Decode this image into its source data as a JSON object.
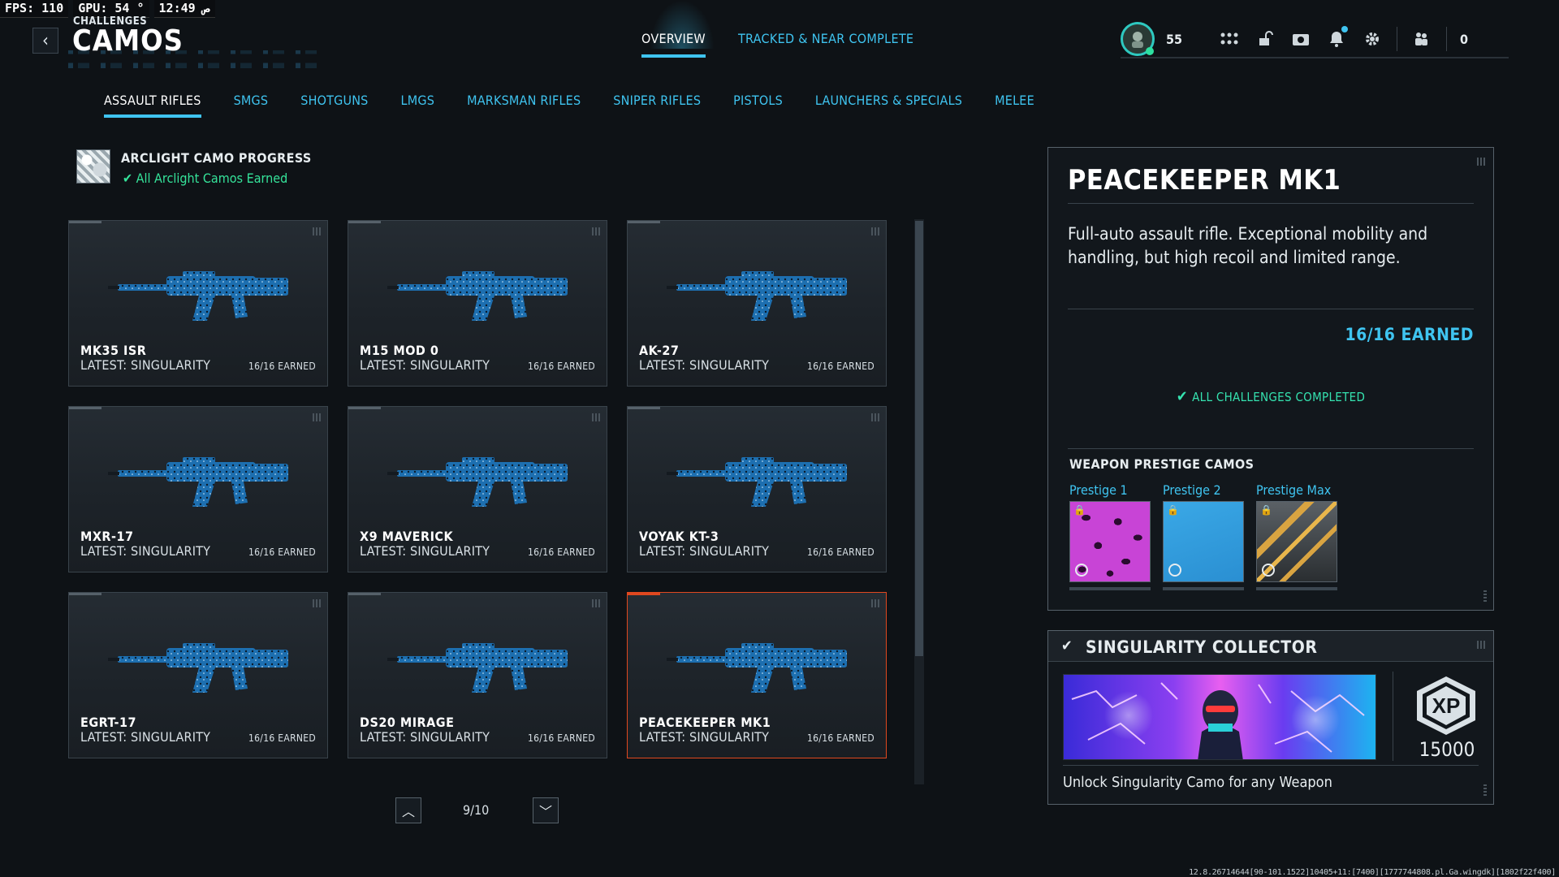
{
  "hud": {
    "fps": "FPS: 110",
    "gpu": "GPU: 54 °",
    "time": "12:49 ص"
  },
  "header": {
    "breadcrumb": "CHALLENGES",
    "title": "CAMOS",
    "tabs": [
      {
        "label": "OVERVIEW",
        "active": true
      },
      {
        "label": "TRACKED & NEAR COMPLETE",
        "active": false
      }
    ],
    "player_level": "55",
    "party_count": "0",
    "icons": [
      "grid-icon",
      "unlock-icon",
      "camera-icon",
      "bell-icon",
      "gear-icon",
      "party-icon"
    ]
  },
  "categories": [
    {
      "label": "ASSAULT RIFLES",
      "active": true
    },
    {
      "label": "SMGS"
    },
    {
      "label": "SHOTGUNS"
    },
    {
      "label": "LMGS"
    },
    {
      "label": "MARKSMAN RIFLES"
    },
    {
      "label": "SNIPER RIFLES"
    },
    {
      "label": "PISTOLS"
    },
    {
      "label": "LAUNCHERS & SPECIALS"
    },
    {
      "label": "MELEE"
    }
  ],
  "arclight": {
    "title": "ARCLIGHT CAMO PROGRESS",
    "status": "All Arclight Camos Earned",
    "status_color": "#35e39a"
  },
  "weapons": [
    {
      "name": "MK35 ISR",
      "latest": "LATEST: SINGULARITY",
      "earned": "16/16 EARNED"
    },
    {
      "name": "M15 MOD 0",
      "latest": "LATEST: SINGULARITY",
      "earned": "16/16 EARNED"
    },
    {
      "name": "AK-27",
      "latest": "LATEST: SINGULARITY",
      "earned": "16/16 EARNED"
    },
    {
      "name": "MXR-17",
      "latest": "LATEST: SINGULARITY",
      "earned": "16/16 EARNED"
    },
    {
      "name": "X9 MAVERICK",
      "latest": "LATEST: SINGULARITY",
      "earned": "16/16 EARNED"
    },
    {
      "name": "VOYAK KT-3",
      "latest": "LATEST: SINGULARITY",
      "earned": "16/16 EARNED"
    },
    {
      "name": "EGRT-17",
      "latest": "LATEST: SINGULARITY",
      "earned": "16/16 EARNED"
    },
    {
      "name": "DS20 MIRAGE",
      "latest": "LATEST: SINGULARITY",
      "earned": "16/16 EARNED"
    },
    {
      "name": "PEACEKEEPER MK1",
      "latest": "LATEST: SINGULARITY",
      "earned": "16/16 EARNED",
      "selected": true
    }
  ],
  "pager": {
    "label": "9/10"
  },
  "detail": {
    "weapon_name": "PEACEKEEPER MK1",
    "description": "Full-auto assault rifle. Exceptional mobility and handling, but high recoil and limited range.",
    "earned": "16/16 EARNED",
    "all_challenges": "ALL CHALLENGES COMPLETED",
    "prestige_header": "WEAPON PRESTIGE CAMOS",
    "prestige": [
      {
        "label": "Prestige 1",
        "locked": true
      },
      {
        "label": "Prestige 2",
        "locked": true
      },
      {
        "label": "Prestige Max",
        "locked": true
      }
    ]
  },
  "challenge": {
    "title": "SINGULARITY COLLECTOR",
    "xp_badge": "XP",
    "xp": "15000",
    "description": "Unlock Singularity Camo for any Weapon"
  },
  "build_info": "12.8.26714644[90-101.1522]10405+11:[7400][1777744808.pl.Ga.wingdk][1802f22f400]",
  "colors": {
    "accent": "#3fc4f0",
    "success": "#35e39a",
    "selected_border": "#e0481f",
    "background": "#0e1216"
  }
}
